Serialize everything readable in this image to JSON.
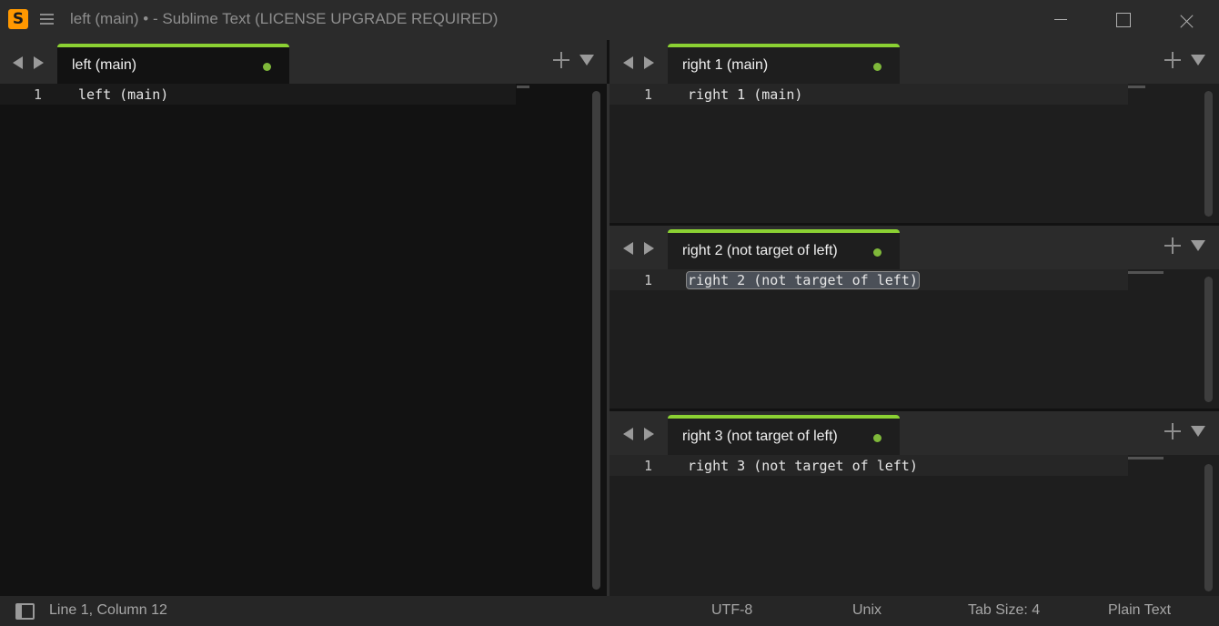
{
  "window": {
    "title": "left (main) • - Sublime Text (LICENSE UPGRADE REQUIRED)",
    "logo_letter": "S"
  },
  "panes": {
    "left": {
      "tab_label": "left (main)",
      "line_number": "1",
      "code": "left (main)"
    },
    "right1": {
      "tab_label": "right 1 (main)",
      "line_number": "1",
      "code": "right 1 (main)"
    },
    "right2": {
      "tab_label": "right 2 (not target of left)",
      "line_number": "1",
      "code": "right 2 (not target of left)"
    },
    "right3": {
      "tab_label": "right 3 (not target of left)",
      "line_number": "1",
      "code": "right 3 (not target of left)"
    }
  },
  "status": {
    "position": "Line 1, Column 12",
    "encoding": "UTF-8",
    "line_endings": "Unix",
    "tab_size": "Tab Size: 4",
    "syntax": "Plain Text"
  },
  "colors": {
    "accent": "#8bd133",
    "dirty_dot": "#7fb83a",
    "logo": "#ff9800"
  }
}
